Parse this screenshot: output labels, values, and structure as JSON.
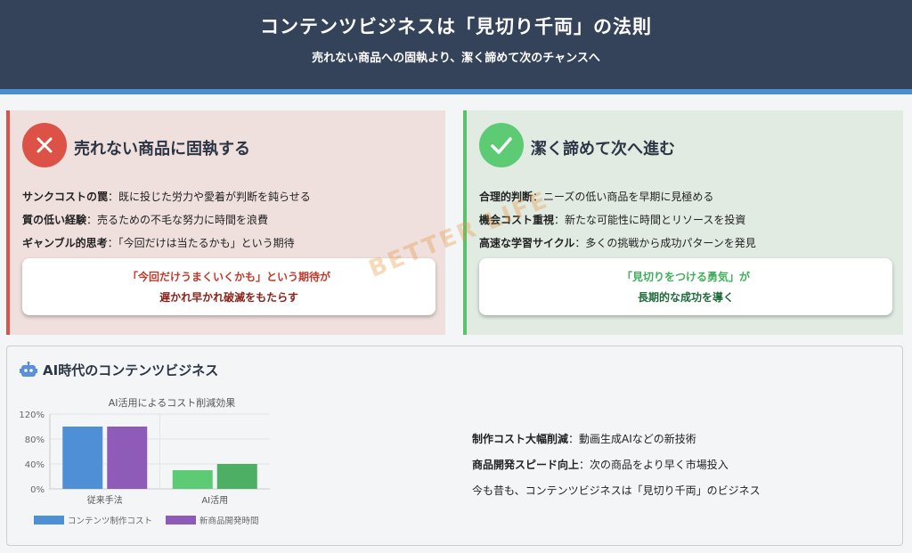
{
  "header": {
    "title": "コンテンツビジネスは「見切り千両」の法則",
    "subtitle": "売れない商品への固執より、潔く諦めて次のチャンスへ"
  },
  "left_panel": {
    "icon": "x-icon",
    "accent": "#dc5246",
    "title": "売れない商品に固執する",
    "bullets": [
      {
        "term": "サンクコストの罠",
        "text": "：既に投じた労力や愛着が判断を鈍らせる"
      },
      {
        "term": "質の低い経験",
        "text": "：売るための不毛な努力に時間を浪費"
      },
      {
        "term": "ギャンブル的思考",
        "text": "：「今回だけは当たるかも」という期待"
      }
    ],
    "callout_line1": "「今回だけうまくいくかも」という期待が",
    "callout_line2": "遅かれ早かれ破滅をもたらす"
  },
  "right_panel": {
    "icon": "check-icon",
    "accent": "#5ccb73",
    "title": "潔く諦めて次へ進む",
    "bullets": [
      {
        "term": "合理的判断",
        "text": "：ニーズの低い商品を早期に見極める"
      },
      {
        "term": "機会コスト重視",
        "text": "：新たな可能性に時間とリソースを投資"
      },
      {
        "term": "高速な学習サイクル",
        "text": "：多くの挑戦から成功パターンを発見"
      }
    ],
    "callout_line1": "「見切りをつける勇気」が",
    "callout_line2": "長期的な成功を導く"
  },
  "watermark": "BETTER LIFE",
  "ai_section": {
    "icon": "robot-icon",
    "title": "AI時代のコンテンツビジネス",
    "points": [
      {
        "term": "制作コスト大幅削減",
        "text": "：動画生成AIなどの新技術"
      },
      {
        "term": "商品開発スピード向上",
        "text": "：次の商品をより早く市場投入"
      },
      {
        "term": "",
        "text": "今も昔も、コンテンツビジネスは「見切り千両」のビジネス"
      }
    ]
  },
  "chart_data": {
    "type": "bar",
    "title": "AI活用によるコスト削減効果",
    "categories": [
      "従来手法",
      "AI活用"
    ],
    "series": [
      {
        "name": "コンテンツ制作コスト",
        "values": [
          100,
          30
        ],
        "colors": [
          "#4f8fd6",
          "#5ccb73"
        ]
      },
      {
        "name": "新商品開発時間",
        "values": [
          100,
          40
        ],
        "colors": [
          "#8e5cb8",
          "#4caf63"
        ]
      }
    ],
    "legend_colors": [
      "#4f8fd6",
      "#8e5cb8"
    ],
    "ylim": [
      0,
      120
    ],
    "yticks": [
      "0%",
      "40%",
      "80%",
      "120%"
    ],
    "ytick_values": [
      0,
      40,
      80,
      120
    ],
    "grid": true,
    "legend": "bottom"
  }
}
